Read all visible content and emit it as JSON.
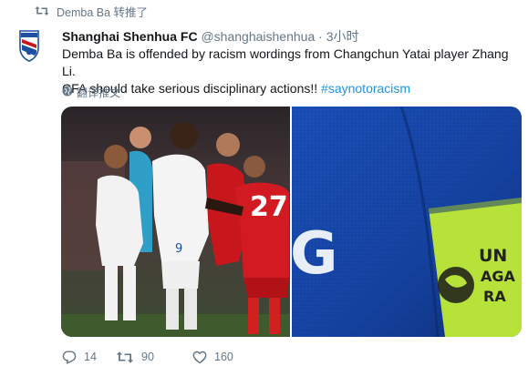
{
  "retweet_context": {
    "icon": "retweet-icon",
    "text": "Demba Ba 转推了"
  },
  "tweet": {
    "author_name": "Shanghai Shenhua FC",
    "author_handle": "@shanghaishenhua",
    "separator": " · ",
    "time": "3小时",
    "text_line1": "Demba Ba is offended by racism wordings from Changchun Yatai player Zhang Li.",
    "text_line2_prefix": "CFA should take serious disciplinary actions!! ",
    "hashtag": "#saynotoracism",
    "translate_label": "翻译推文",
    "translate_icon": "globe-icon"
  },
  "media": {
    "left_photo": {
      "jersey_number": "27",
      "shorts_number": "9"
    },
    "right_photo": {
      "armband_text": [
        "UN",
        "AGA",
        "RA"
      ],
      "jersey_letter": "G"
    }
  },
  "actions": {
    "reply_count": "14",
    "retweet_count": "90",
    "like_count": "160"
  },
  "colors": {
    "link": "#1b95e0",
    "muted": "#657786",
    "shenhua_blue": "#1d4fa3",
    "opponent_red": "#c8161d",
    "armband_green": "#b6e23a"
  }
}
